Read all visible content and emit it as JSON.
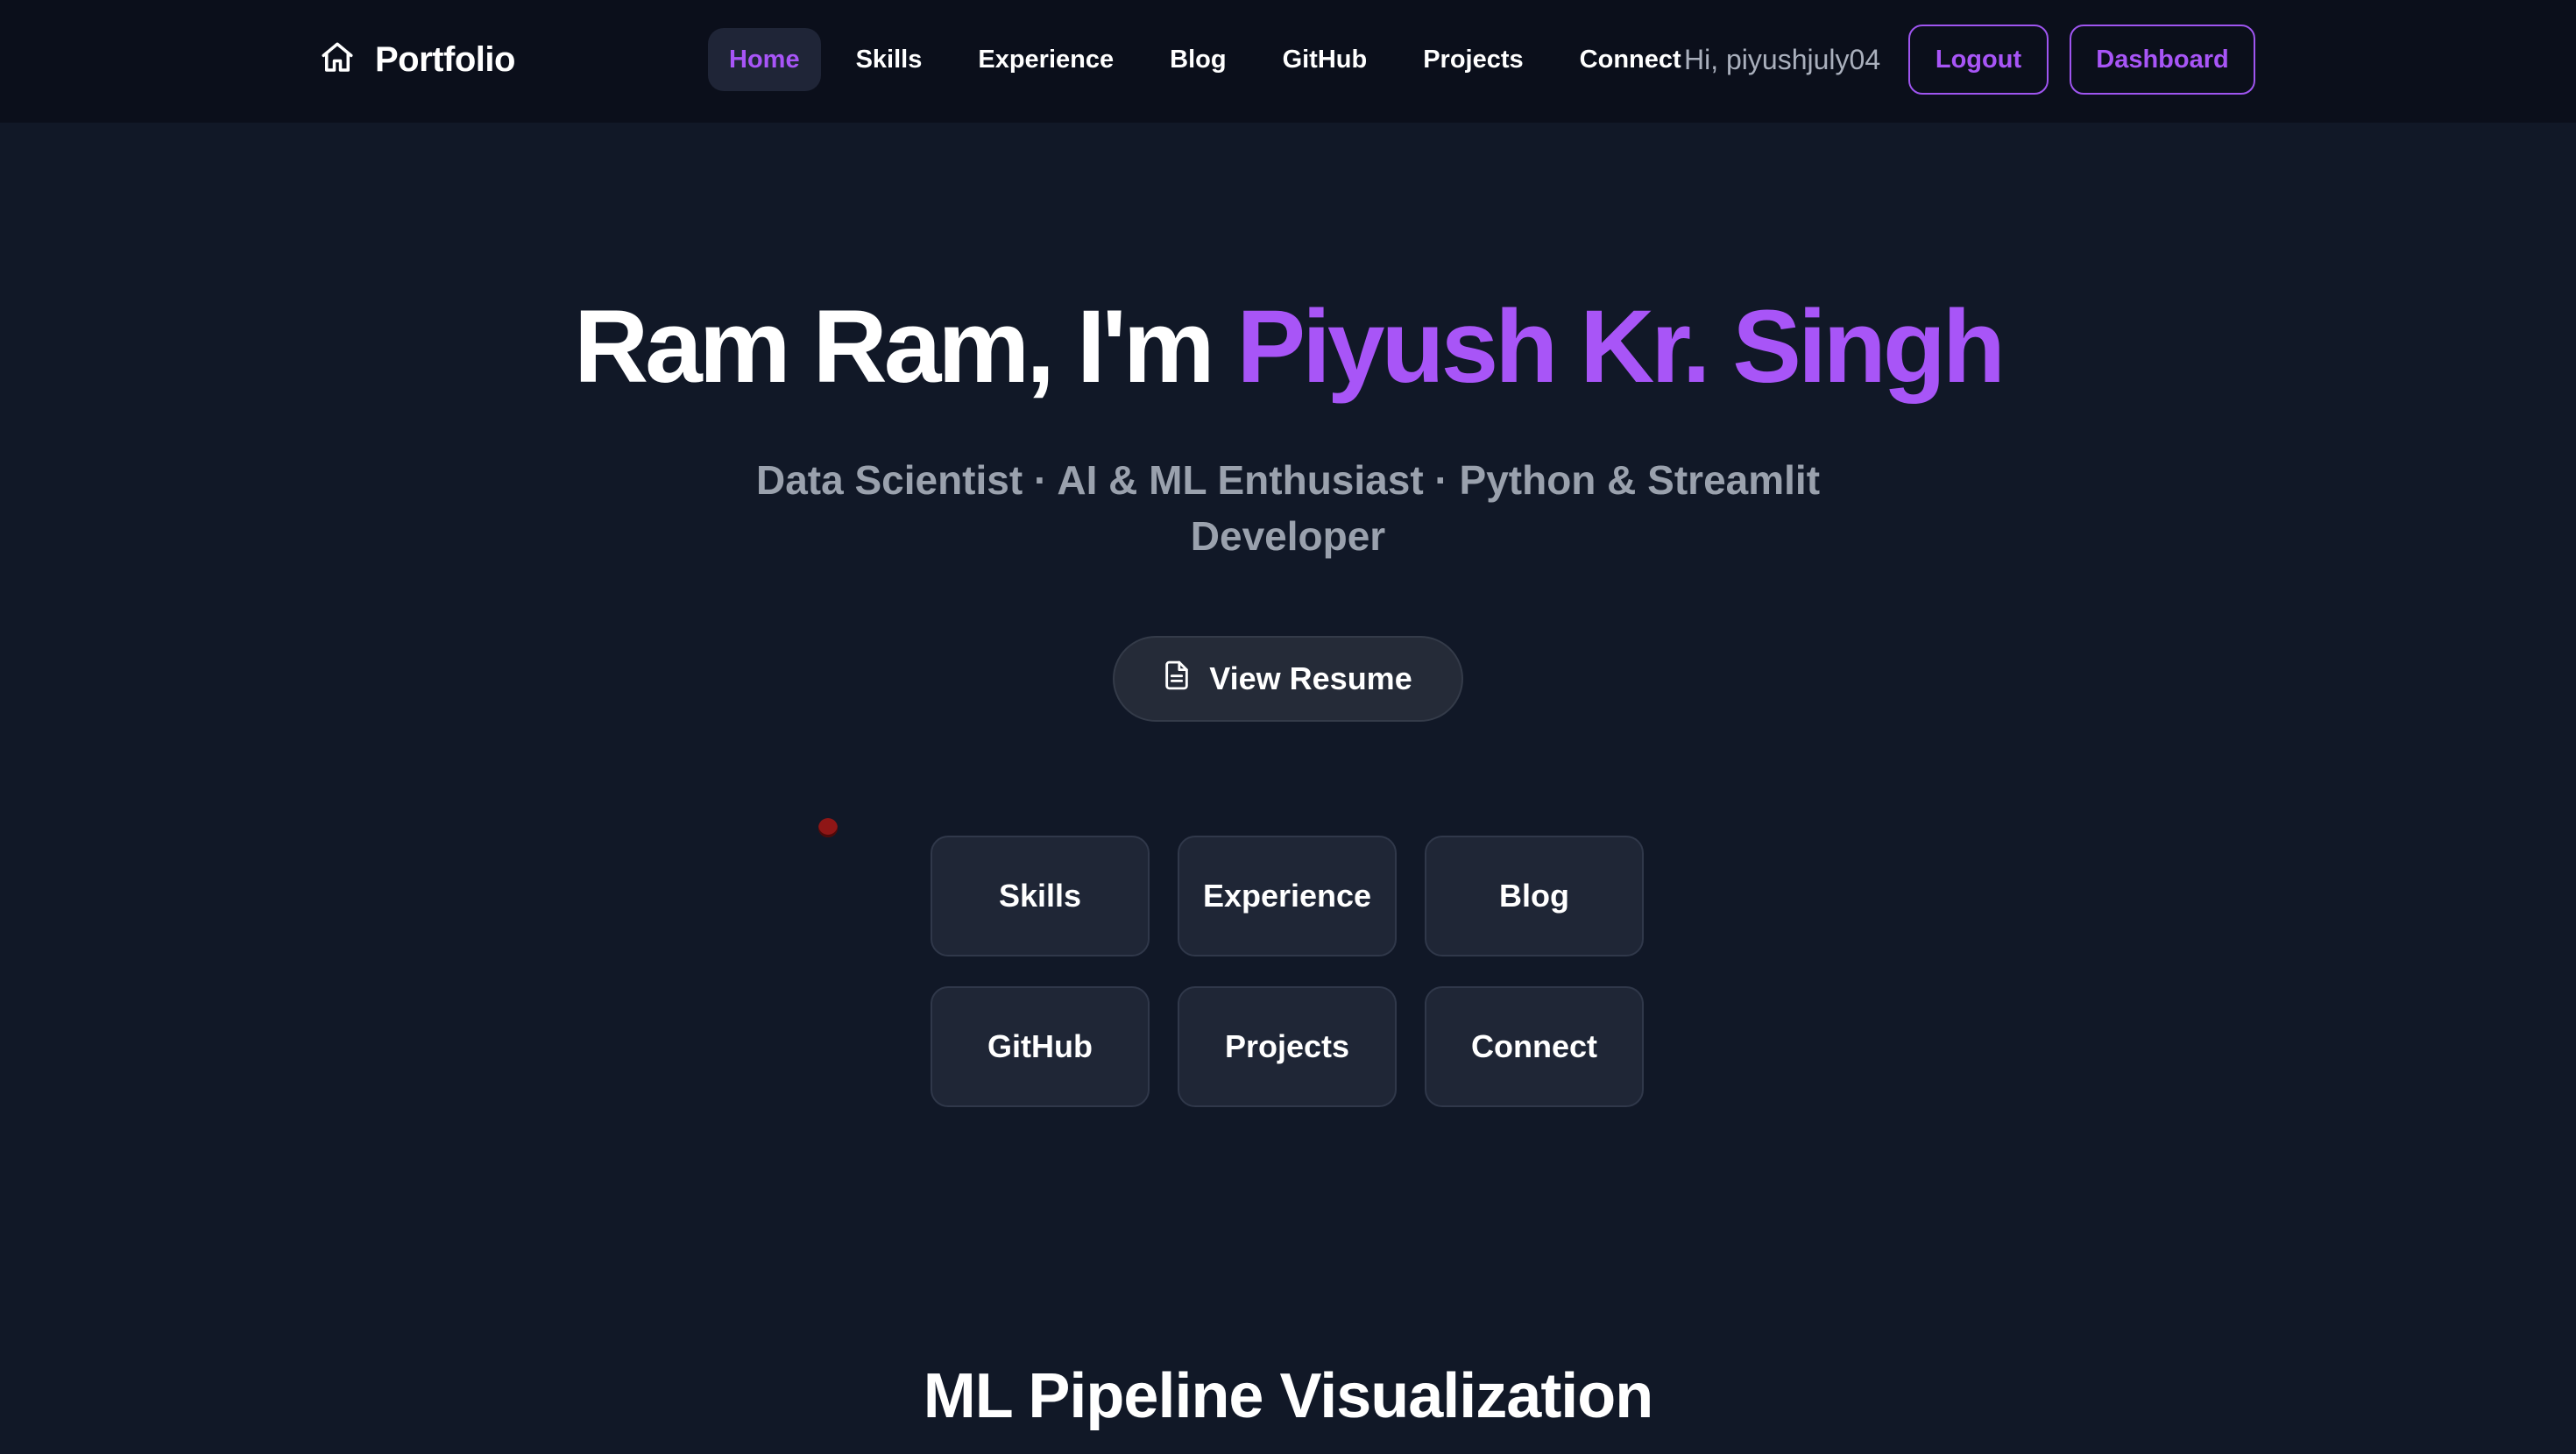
{
  "nav": {
    "brand_icon": "home-icon",
    "brand": "Portfolio",
    "links": [
      {
        "label": "Home",
        "active": true
      },
      {
        "label": "Skills",
        "active": false
      },
      {
        "label": "Experience",
        "active": false
      },
      {
        "label": "Blog",
        "active": false
      },
      {
        "label": "GitHub",
        "active": false
      },
      {
        "label": "Projects",
        "active": false
      },
      {
        "label": "Connect",
        "active": false
      }
    ],
    "greeting": "Hi, piyushjuly04",
    "logout_label": "Logout",
    "dashboard_label": "Dashboard"
  },
  "hero": {
    "title_prefix": "Ram Ram, I'm ",
    "title_name": "Piyush Kr. Singh",
    "subtitle": "Data Scientist · AI & ML Enthusiast · Python & Streamlit Developer",
    "resume_icon": "document-icon",
    "resume_label": "View Resume"
  },
  "tiles": [
    "Skills",
    "Experience",
    "Blog",
    "GitHub",
    "Projects",
    "Connect"
  ],
  "section": {
    "title": "ML Pipeline Visualization"
  },
  "colors": {
    "background": "#111827",
    "navbar": "#0b0f1b",
    "accent": "#a855f7",
    "tile": "#1f2636",
    "muted_text": "#9aa1ad"
  }
}
